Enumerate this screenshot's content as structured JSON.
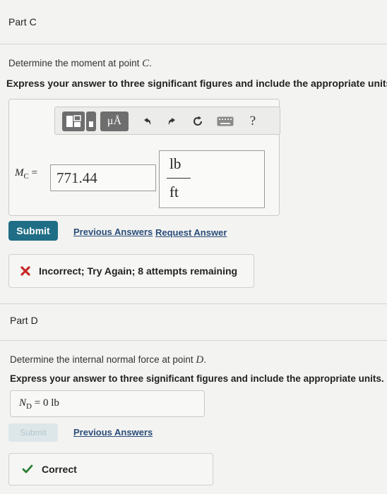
{
  "partC": {
    "title": "Part C",
    "prompt_text": "Determine the moment at point ",
    "prompt_var": "C",
    "instruction": "Express your answer to three significant figures and include the appropriate units",
    "toolbar": {
      "templates_icon": "matrix-template-icon",
      "units_label": "μÅ",
      "undo_icon": "undo-icon",
      "redo_icon": "redo-icon",
      "reset_icon": "reset-icon",
      "keyboard_icon": "keyboard-icon",
      "help_label": "?"
    },
    "answer": {
      "label_var": "M",
      "label_sub": "C",
      "label_eq": "=",
      "value": "771.44",
      "unit_num": "lb",
      "unit_den": "ft"
    },
    "submit_label": "Submit",
    "previous_answers_label": "Previous Answers",
    "request_answer_label": "Request Answer",
    "feedback": {
      "icon": "x-icon",
      "text": "Incorrect; Try Again; 8 attempts remaining",
      "color": "#c62828"
    }
  },
  "partD": {
    "title": "Part D",
    "prompt_text": "Determine the internal normal force at point ",
    "prompt_var": "D",
    "instruction": "Express your answer to three significant figures and include the appropriate units.",
    "answer": {
      "label_var": "N",
      "label_sub": "D",
      "label_eq": "=",
      "value": "0",
      "unit": "lb"
    },
    "submit_label": "Submit",
    "previous_answers_label": "Previous Answers",
    "feedback": {
      "icon": "check-icon",
      "text": "Correct",
      "color": "#2e7d32"
    }
  }
}
